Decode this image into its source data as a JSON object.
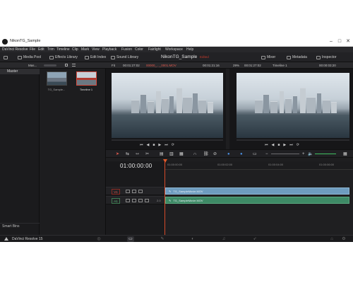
{
  "window": {
    "title": "NikonTG_Sample"
  },
  "menu": [
    "DaVinci Resolve",
    "File",
    "Edit",
    "Trim",
    "Timeline",
    "Clip",
    "Mark",
    "View",
    "Playback",
    "Fusion",
    "Color",
    "Fairlight",
    "Workspace",
    "Help"
  ],
  "toolbar": {
    "media_pool": "Media Pool",
    "effects_library": "Effects Library",
    "edit_index": "Edit Index",
    "sound_library": "Sound Library",
    "project_name": "NikonTG_Sample",
    "edited": "Edited",
    "mixer": "Mixer",
    "metadata": "Metadata",
    "inspector": "Inspector"
  },
  "subheader": {
    "bin_label": "Mas...",
    "source_fit": "Fit",
    "source_tc": "00:01:27:02",
    "source_clip": "00000_..._0001.MOV",
    "source_duration": "00:01:21:16",
    "zoom": "29%",
    "timeline_tc": "00:01:27:02",
    "timeline_name": "Timeline 1",
    "record_tc": "00:00:03:20"
  },
  "bins": {
    "master": "Master",
    "smart_bins": "Smart Bins"
  },
  "media_pool": [
    {
      "label": "TG_Sample...",
      "selected": false
    },
    {
      "label": "Timeline 1",
      "selected": true
    }
  ],
  "timeline": {
    "timecode": "01:00:00:00",
    "ruler": [
      "01:00:00:00",
      "01:00:02:00",
      "01:00:04:00",
      "01:00:06:00"
    ],
    "tracks": [
      {
        "id": "V1",
        "clip": "TG_SampleMovie.MOV",
        "kind": "video"
      },
      {
        "id": "A1",
        "clip": "TG_SampleMovie.MOV",
        "kind": "audio",
        "level": "2.0"
      }
    ]
  },
  "footer": {
    "app": "DaVinci Resolve 15"
  }
}
